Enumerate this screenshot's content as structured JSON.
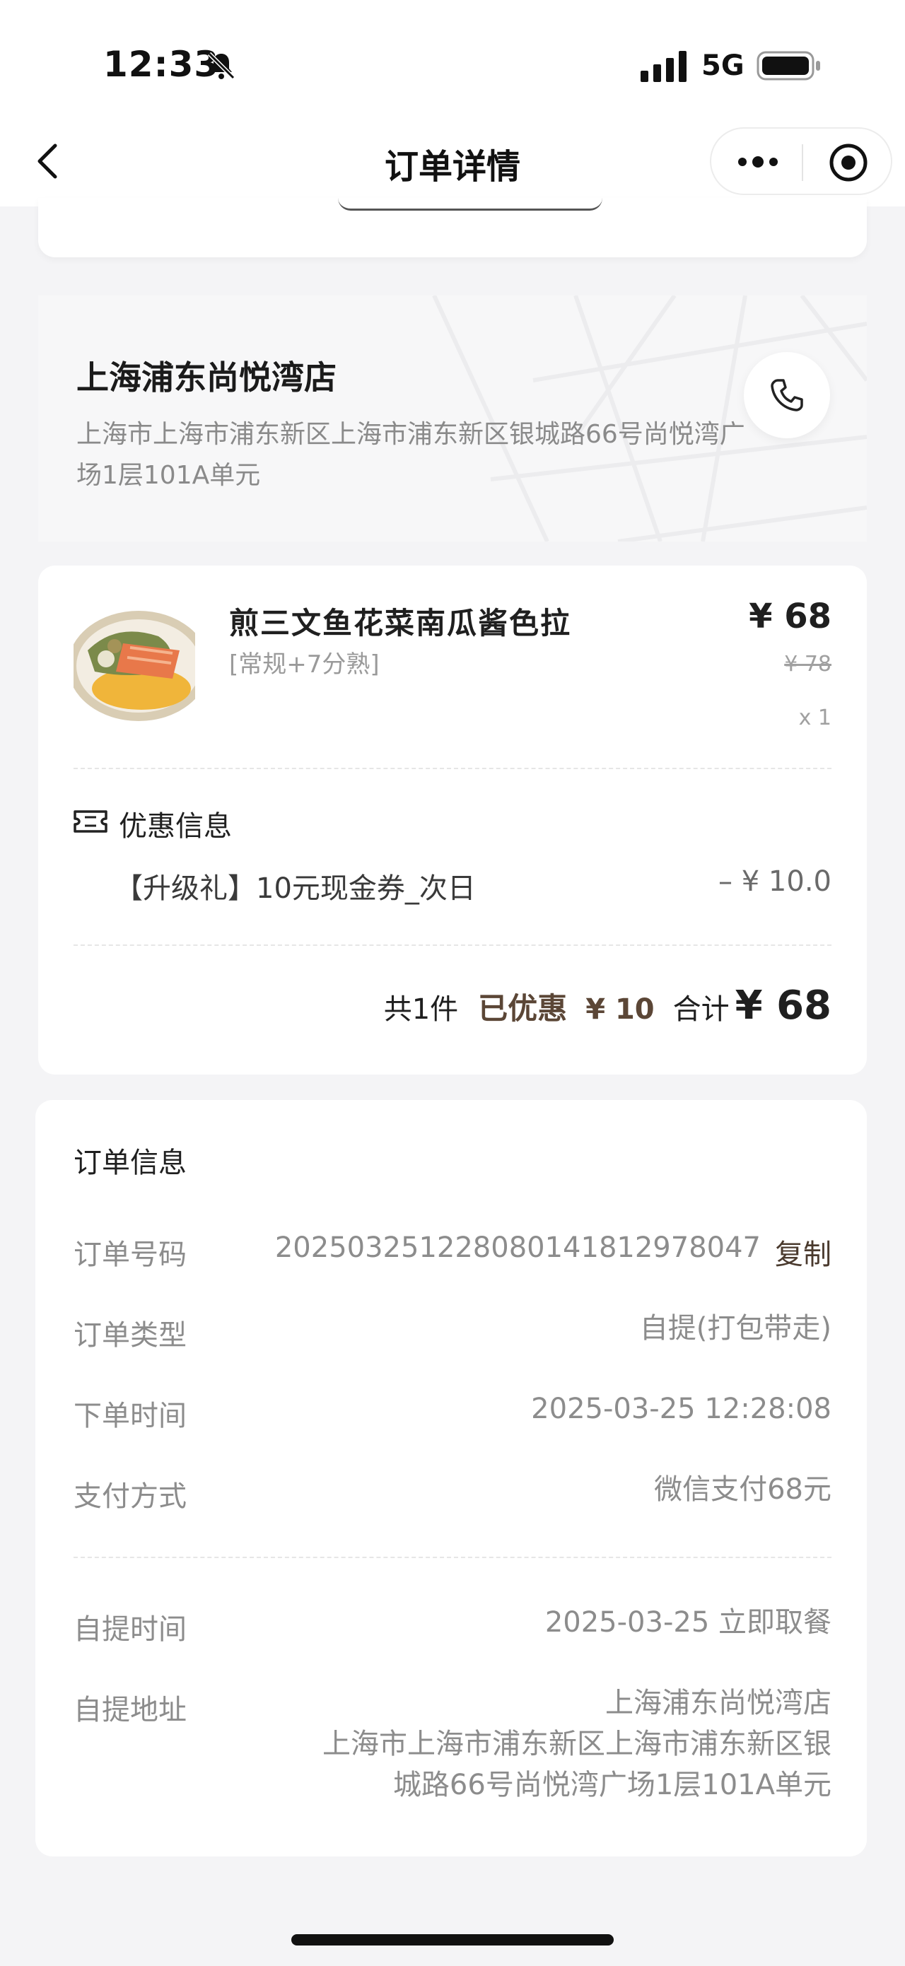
{
  "status_bar": {
    "time": "12:33",
    "network": "5G"
  },
  "nav": {
    "title": "订单详情"
  },
  "store": {
    "name": "上海浦东尚悦湾店",
    "address": "上海市上海市浦东新区上海市浦东新区银城路66号尚悦湾广场1层101A单元"
  },
  "item": {
    "name": "煎三文鱼花菜南瓜酱色拉",
    "spec": "[常规+7分熟]",
    "price": "¥ 68",
    "original_price": "¥ 78",
    "quantity": "x 1"
  },
  "coupon": {
    "title": "优惠信息",
    "name": "【升级礼】10元现金券_次日",
    "amount": "– ¥ 10.0"
  },
  "summary": {
    "count": "共1件",
    "discount_label": "已优惠",
    "discount_amount": "¥ 10",
    "total_label": "合计",
    "total": "¥ 68"
  },
  "order_info": {
    "title": "订单信息",
    "copy_label": "复制",
    "rows": [
      {
        "label": "订单号码",
        "value": "2025032512280801418129780​47"
      },
      {
        "label": "订单类型",
        "value": "自提(打包带走)"
      },
      {
        "label": "下单时间",
        "value": "2025-03-25 12:28:08"
      },
      {
        "label": "支付方式",
        "value": "微信支付68元"
      },
      {
        "label": "自提时间",
        "value": "2025-03-25 立即取餐"
      },
      {
        "label": "自提地址",
        "value_lines": [
          "上海浦东尚悦湾店",
          "上海市上海市浦东新区上海市浦东新区银",
          "城路66号尚悦湾广场1层101A单元"
        ]
      }
    ]
  },
  "colors": {
    "accent_brown": "#5b4636",
    "text_gray": "#8c8c8c",
    "background": "#f4f4f6"
  }
}
